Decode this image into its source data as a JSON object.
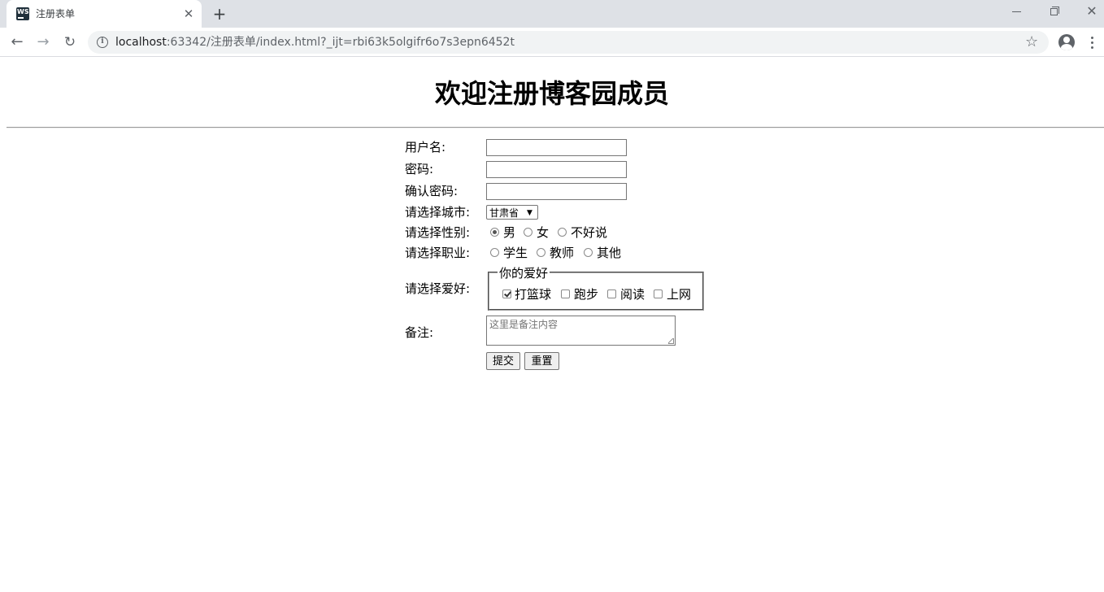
{
  "browser": {
    "tab_title": "注册表单",
    "favicon_text": "WS",
    "close_tab_glyph": "✕",
    "new_tab_glyph": "+",
    "url_host": "localhost",
    "url_rest": ":63342/注册表单/index.html?_ijt=rbi63k5olgifr6o7s3epn6452t",
    "icons": [
      "back-arrow-icon",
      "forward-arrow-icon",
      "reload-icon",
      "info-icon",
      "star-icon",
      "account-icon",
      "menu-dots-icon"
    ]
  },
  "page": {
    "title": "欢迎注册博客园成员",
    "form": {
      "username_label": "用户名:",
      "username_value": "",
      "password_label": "密码:",
      "password_value": "",
      "confirm_label": "确认密码:",
      "confirm_value": "",
      "city_label": "请选择城市:",
      "city_selected": "甘肃省",
      "gender_label": "请选择性别:",
      "gender_options": [
        "男",
        "女",
        "不好说"
      ],
      "gender_selected": "男",
      "job_label": "请选择职业:",
      "job_options": [
        "学生",
        "教师",
        "其他"
      ],
      "hobby_label": "请选择爱好:",
      "hobby_legend": "你的爱好",
      "hobby_options": [
        "打篮球",
        "跑步",
        "阅读",
        "上网"
      ],
      "hobby_checked": [
        "打篮球"
      ],
      "remark_label": "备注:",
      "remark_placeholder": "这里是备注内容",
      "submit_label": "提交",
      "reset_label": "重置"
    }
  },
  "colors": {
    "tabbar_bg": "#dee1e6",
    "omnibox_bg": "#f1f3f4",
    "text": "#000000",
    "chrome_icon": "#5f6368"
  }
}
